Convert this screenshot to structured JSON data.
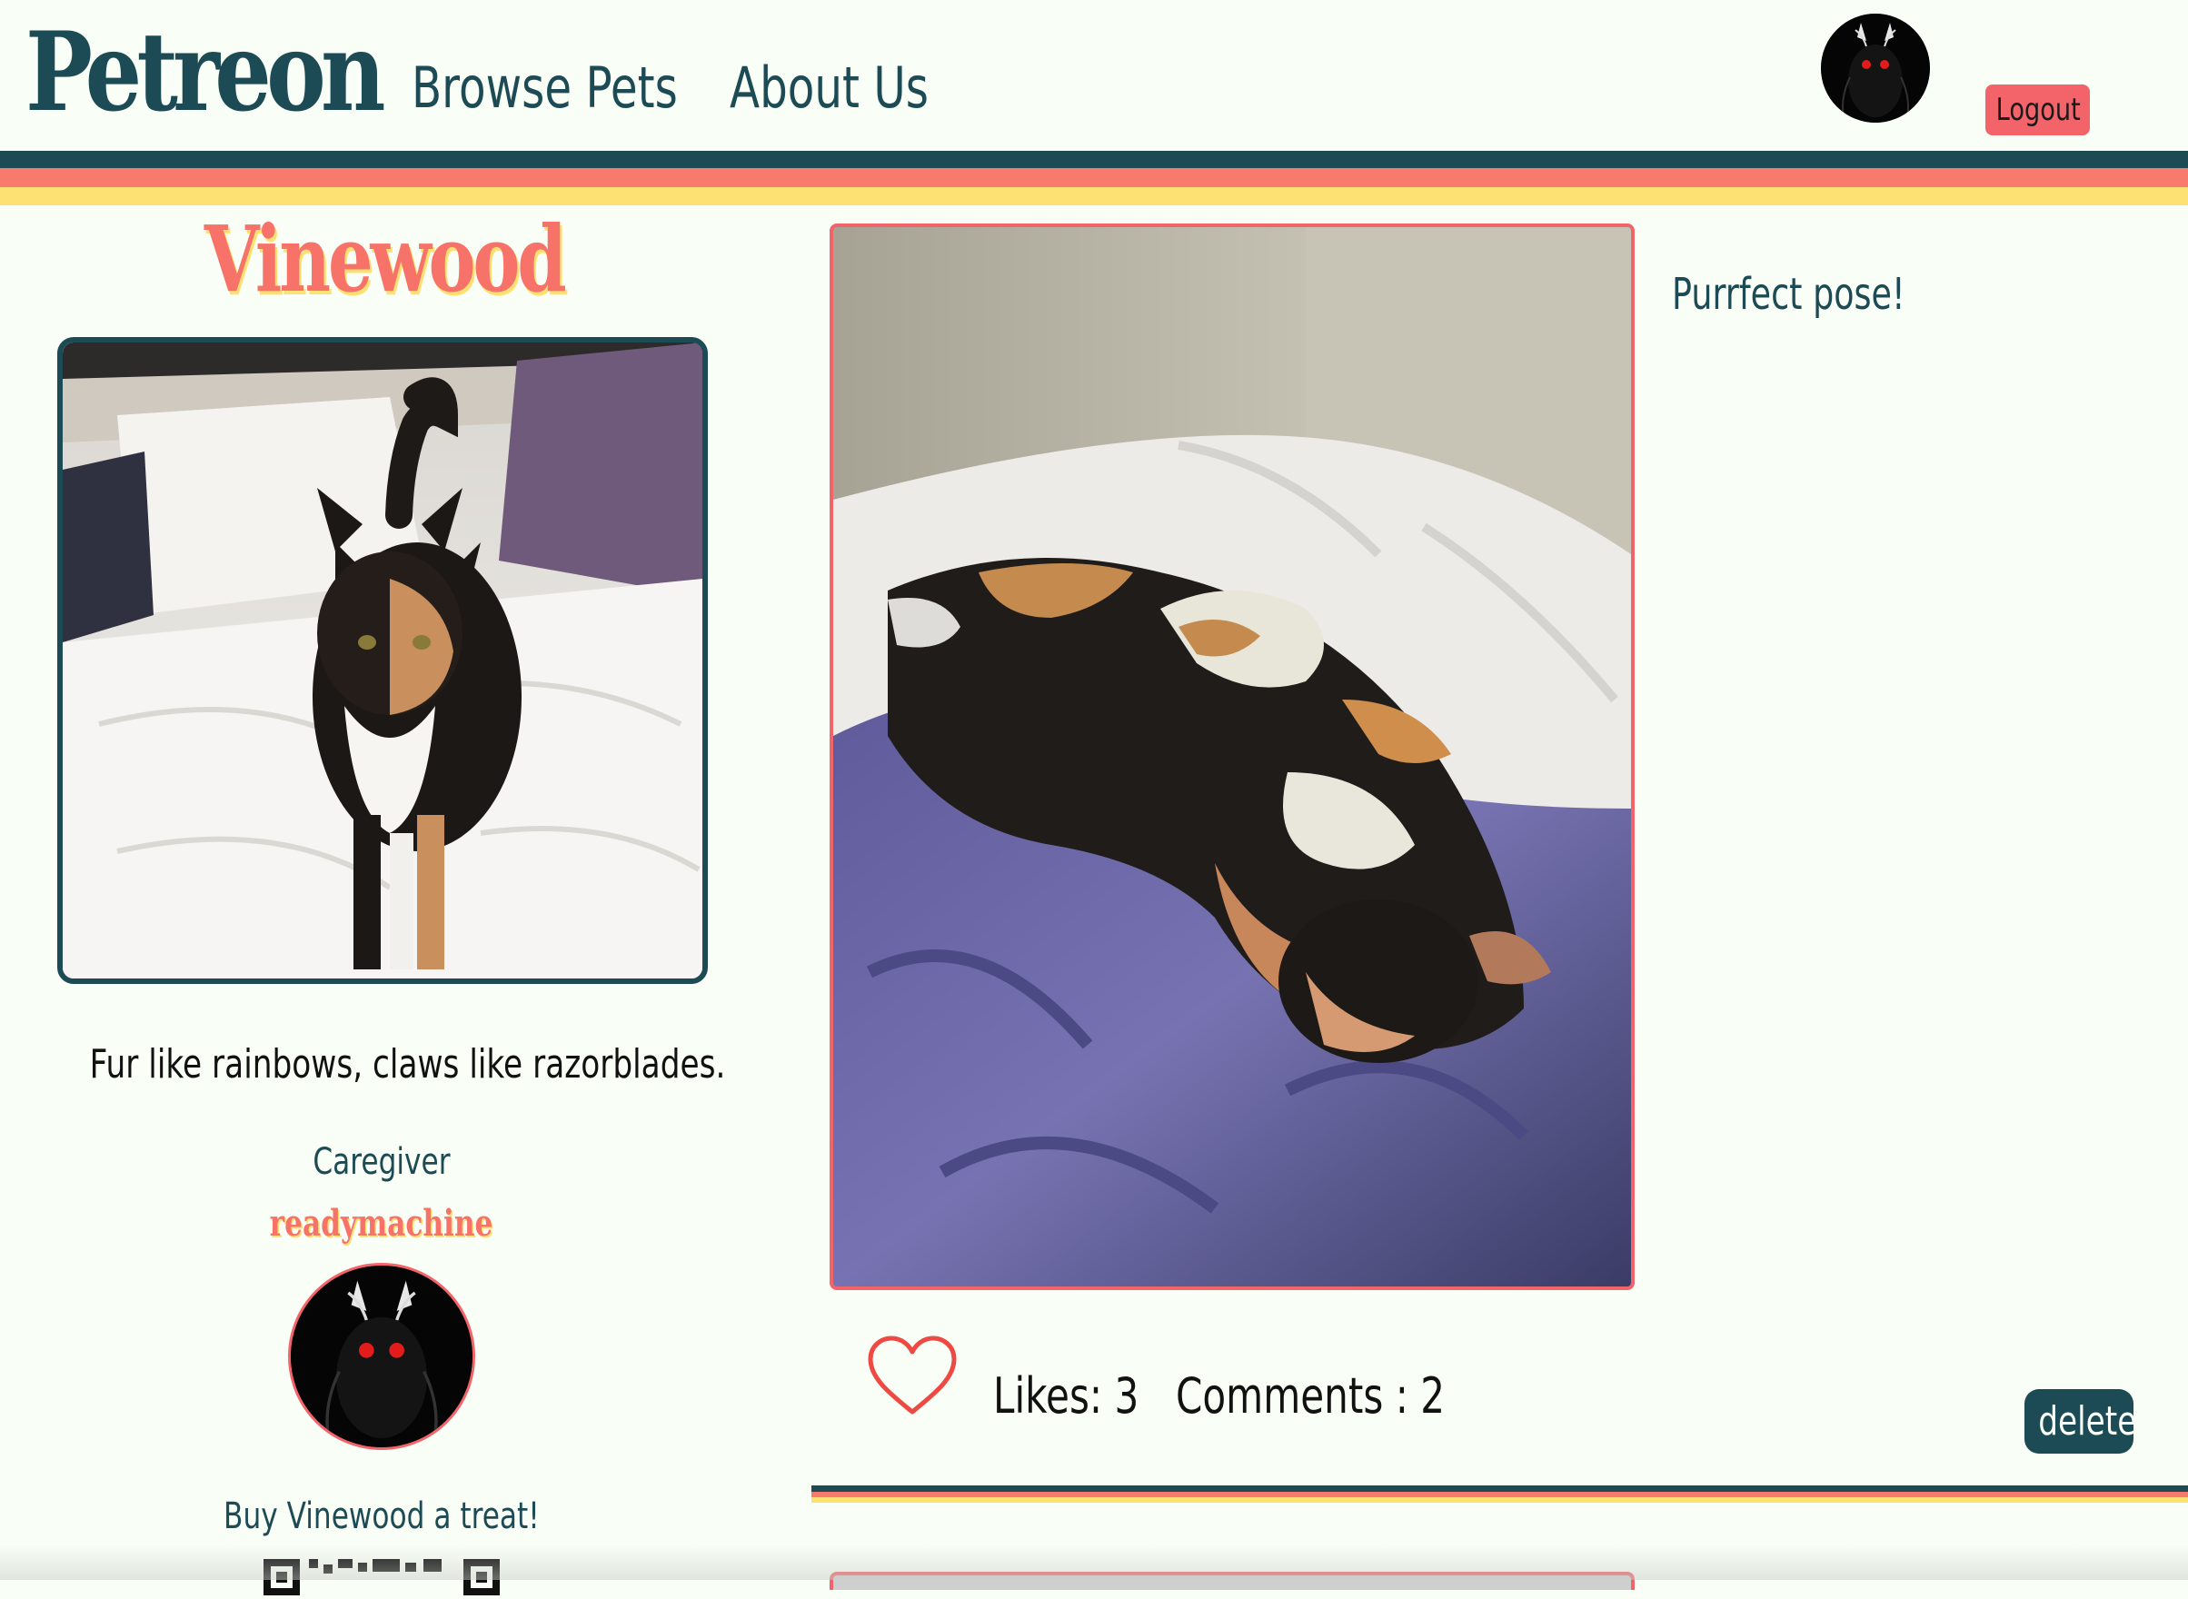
{
  "header": {
    "logo": "Petreon",
    "nav": {
      "browse_pets": "Browse Pets",
      "about_us": "About Us"
    },
    "logout_label": "Logout"
  },
  "colors": {
    "teal": "#1d4b55",
    "coral": "#f77a6c",
    "yellow": "#fde273",
    "background": "#f9fef6",
    "button_red": "#f2646a"
  },
  "pet": {
    "name": "Vinewood",
    "bio": "Fur like rainbows, claws like razorblades.",
    "caregiver_label": "Caregiver",
    "caregiver_name": "readymachine",
    "treat_label": "Buy Vinewood a treat!"
  },
  "post": {
    "caption": "Purrfect pose!",
    "likes_text": "Likes: 3",
    "comments_text": "Comments : 2",
    "delete_label": "delete"
  },
  "icons": {
    "like": "heart-outline-icon",
    "avatar": "moth-avatar-icon",
    "qr": "qr-code-icon"
  }
}
